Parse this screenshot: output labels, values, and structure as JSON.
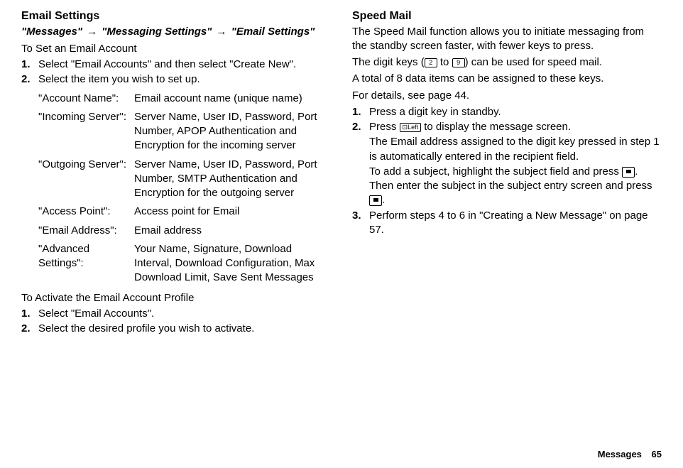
{
  "left": {
    "title": "Email Settings",
    "breadcrumb": {
      "a": "\"Messages\"",
      "b": "\"Messaging Settings\"",
      "c": "\"Email Settings\""
    },
    "subheading1": "To Set an Email Account",
    "steps1": {
      "s1": {
        "num": "1.",
        "text": "Select \"Email Accounts\" and then select \"Create New\"."
      },
      "s2": {
        "num": "2.",
        "text": "Select the item you wish to set up."
      }
    },
    "defs": {
      "d1": {
        "term": "\"Account Name\":",
        "desc": "Email account name (unique name)"
      },
      "d2": {
        "term": "\"Incoming Server\":",
        "desc": "Server Name, User ID, Password, Port Number, APOP Authentication and Encryption for the incoming server"
      },
      "d3": {
        "term": "\"Outgoing Server\":",
        "desc": "Server Name, User ID, Password, Port Number, SMTP Authentication and Encryption for the outgoing server"
      },
      "d4": {
        "term": "\"Access Point\":",
        "desc": "Access point for Email"
      },
      "d5": {
        "term": "\"Email Address\":",
        "desc": "Email address"
      },
      "d6": {
        "term": "\"Advanced Settings\":",
        "desc": "Your Name, Signature, Download Interval, Download Configuration, Max Download Limit, Save Sent Messages"
      }
    },
    "subheading2": "To Activate the Email Account Profile",
    "steps2": {
      "s1": {
        "num": "1.",
        "text": "Select \"Email Accounts\"."
      },
      "s2": {
        "num": "2.",
        "text": "Select the desired profile you wish to activate."
      }
    }
  },
  "right": {
    "title": "Speed Mail",
    "para1": "The Speed Mail function allows you to initiate messaging from the standby screen faster, with fewer keys to press.",
    "para2a": "The digit keys (",
    "key2": "2",
    "para2b": " to ",
    "key9": "9",
    "para2c": ") can be used for speed mail.",
    "para3": "A total of 8 data items can be assigned to these keys.",
    "para4": "For details, see page 44.",
    "steps": {
      "s1": {
        "num": "1.",
        "text": "Press a digit key in standby."
      },
      "s2": {
        "num": "2.",
        "t1": "Press ",
        "keyLeft": "Left",
        "t2": " to display the message screen.",
        "sub1": "The Email address assigned to the digit key pressed in step 1 is automatically entered in the recipient field.",
        "sub2a": "To add a subject, highlight the subject field and press ",
        "sub2b": ". Then enter the subject in the subject entry screen and press ",
        "sub2c": "."
      },
      "s3": {
        "num": "3.",
        "text": "Perform steps 4 to 6 in \"Creating a New Message\" on page 57."
      }
    }
  },
  "footer": {
    "label": "Messages",
    "page": "65"
  }
}
